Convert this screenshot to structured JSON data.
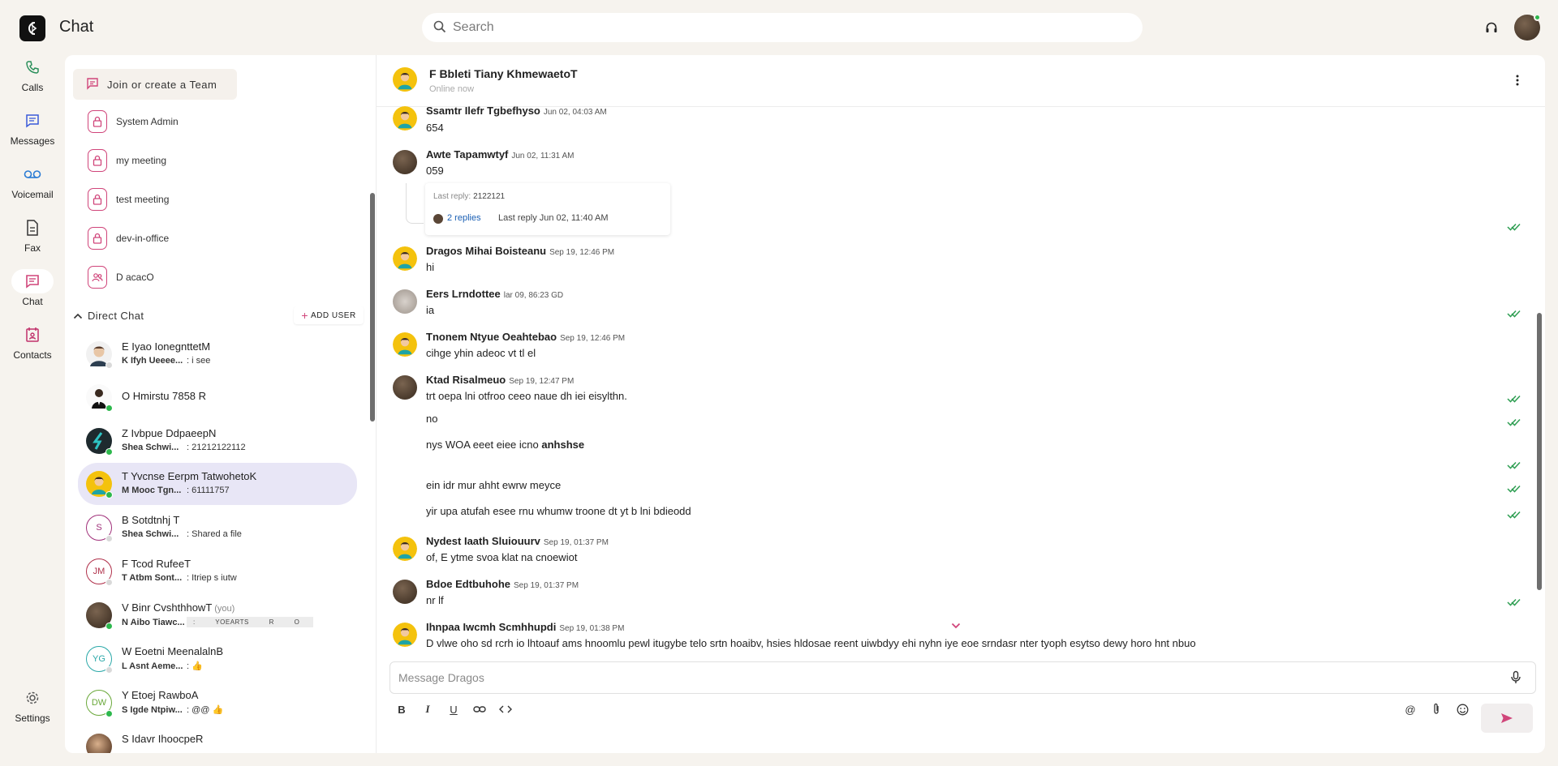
{
  "app": {
    "title": "Chat"
  },
  "search": {
    "placeholder": "Search"
  },
  "nav": {
    "items": [
      {
        "label": "Calls",
        "icon": "phone-icon"
      },
      {
        "label": "Messages",
        "icon": "messages-icon"
      },
      {
        "label": "Voicemail",
        "icon": "voicemail-icon"
      },
      {
        "label": "Fax",
        "icon": "fax-icon"
      },
      {
        "label": "Chat",
        "icon": "chat-icon"
      },
      {
        "label": "Contacts",
        "icon": "contacts-icon"
      }
    ],
    "settings_label": "Settings"
  },
  "sidebar": {
    "join_label": "Join or create a Team",
    "teams": [
      {
        "name": "System Admin",
        "icon": "lock-icon"
      },
      {
        "name": "my meeting",
        "icon": "lock-icon"
      },
      {
        "name": "test meeting",
        "icon": "lock-icon"
      },
      {
        "name": "dev-in-office",
        "icon": "lock-icon"
      },
      {
        "name": "D acacO",
        "icon": "group-icon"
      }
    ],
    "direct_chat_label": "Direct Chat",
    "add_user_label": "ADD USER",
    "contacts": [
      {
        "name": "E Iyao IonegnttetM",
        "sender": "K Ifyh Ueeee...",
        "preview": ": i see",
        "status": "offline"
      },
      {
        "name": "O Hmirstu 7858 R",
        "sender": "",
        "preview": "",
        "status": "online"
      },
      {
        "name": "Z Ivbpue DdpaeepN",
        "sender": "Shea Schwi...",
        "preview": ": 21212122112",
        "status": "online"
      },
      {
        "name": "T Yvcnse Eerpm TatwohetoK",
        "sender": "M Mooc Tgn...",
        "preview": ": 61111757",
        "status": "online"
      },
      {
        "name": "B Sotdtnhj T",
        "sender": "Shea Schwi...",
        "preview": ": Shared a file",
        "status": "offline",
        "initials": "S"
      },
      {
        "name": "F Tcod RufeeT",
        "sender": "T Atbm Sont...",
        "preview": ": Itriep s iutw",
        "status": "offline",
        "initials": "JM"
      },
      {
        "name": "V Binr CvshthhowT",
        "you": "(you)",
        "sender": "N Aibo Tiawc...",
        "pill": ":  YOEARTS   R    O",
        "status": "online"
      },
      {
        "name": "W Eoetni MeenalalnB",
        "sender": "L Asnt Aeme...",
        "preview": ": 👍",
        "status": "offline",
        "initials": "YG"
      },
      {
        "name": "Y Etoej RawboA",
        "sender": "S Igde Ntpiw...",
        "preview": ": @@ 👍",
        "status": "online",
        "initials": "DW"
      },
      {
        "name": "S Idavr IhoocpeR",
        "sender": "",
        "preview": "",
        "status": "offline"
      }
    ]
  },
  "chat": {
    "header_name": "F Bbleti Tiany KhmewaetoT",
    "header_status": "Online now",
    "messages": [
      {
        "author": "Ssamtr Ilefr Tgbefhyso",
        "time": "Jun 02, 04:03 AM",
        "lines": [
          "654"
        ]
      },
      {
        "author": "Awte Tapamwtyf",
        "time": "Jun 02, 11:31 AM",
        "lines": [
          "059"
        ]
      },
      {
        "author": "Dragos Mihai Boisteanu",
        "time": "Sep 19, 12:46 PM",
        "lines": [
          "hi"
        ]
      },
      {
        "author": "Eers Lrndottee",
        "time": "lar 09, 86:23 GD",
        "lines": [
          "ia"
        ]
      },
      {
        "author": "Tnonem Ntyue Oeahtebao",
        "time": "Sep 19, 12:46 PM",
        "lines": [
          "cihge yhin adeoc vt tl el"
        ]
      },
      {
        "author": "Ktad Risalmeuo",
        "time": "Sep 19, 12:47 PM",
        "lines": [
          "trt oepa lni otfroo ceeo naue dh iei eisylthn.",
          "no",
          "nys WOA eeet eiee icno",
          "ein idr mur ahht ewrw meyce",
          "yir upa atufah esee rnu whumw troone dt yt b lni bdieodd"
        ],
        "bold_suffix": "anhshse"
      },
      {
        "author": "Nydest Iaath Sluiouurv",
        "time": "Sep 19, 01:37 PM",
        "lines": [
          "of, E ytme svoa klat na cnoewiot"
        ]
      },
      {
        "author": "Bdoe Edtbuhohe",
        "time": "Sep 19, 01:37 PM",
        "lines": [
          "nr lf"
        ]
      },
      {
        "author": "Ihnpaa Iwcmh Scmhhupdi",
        "time": "Sep 19, 01:38 PM",
        "lines": [
          "D vlwe oho sd rcrh io lhtoauf ams hnoomlu pewl itugybe telo srtn hoaibv, hsies hldosae reent uiwbdyy ehi nyhn iye eoe srndasr nter tyoph esytso dewy horo hnt nbuo"
        ]
      }
    ],
    "thread": {
      "last_reply_label": "Last reply:",
      "last_reply_value": "2122121",
      "replies": "2 replies",
      "last_reply_time": "Last reply Jun 02, 11:40 AM"
    },
    "composer_placeholder": "Message Dragos"
  },
  "colors": {
    "accent": "#d0457a",
    "nav_icon": "#3a5bd9",
    "online": "#2db84d",
    "tick": "#2e9e52",
    "selected_bg": "#e8e6f6"
  }
}
